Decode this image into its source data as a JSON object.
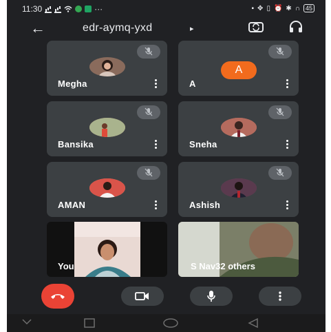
{
  "status": {
    "time": "11:30",
    "battery": "45"
  },
  "meeting": {
    "code": "edr-aymq-yxd",
    "caret": "▸"
  },
  "participants": [
    {
      "name": "Megha",
      "avatar_color": "#8a6b5c"
    },
    {
      "name": "A",
      "avatar_letter": "A",
      "avatar_color": "#f26b1d"
    },
    {
      "name": "Bansika",
      "avatar_color": "#b9826a"
    },
    {
      "name": "Sneha",
      "avatar_color": "#a86d5b"
    },
    {
      "name": "AMAN",
      "avatar_color": "#c98b6c"
    },
    {
      "name": "Ashish",
      "avatar_color": "#6b4b5c"
    }
  ],
  "video_tiles": {
    "self_label": "You",
    "others_label": "S Nav32 others"
  },
  "colors": {
    "background": "#202124",
    "tile": "#3c4043",
    "end_call": "#ea4335",
    "avatar_orange": "#f26b1d"
  },
  "icons": {
    "back": "arrow-left-icon",
    "camera_switch": "camera-switch-icon",
    "audio": "headset-icon",
    "mic_off": "mic-off-icon",
    "more": "more-vertical-icon",
    "end_call": "phone-hangup-icon",
    "video": "video-camera-icon",
    "mic": "mic-icon"
  }
}
